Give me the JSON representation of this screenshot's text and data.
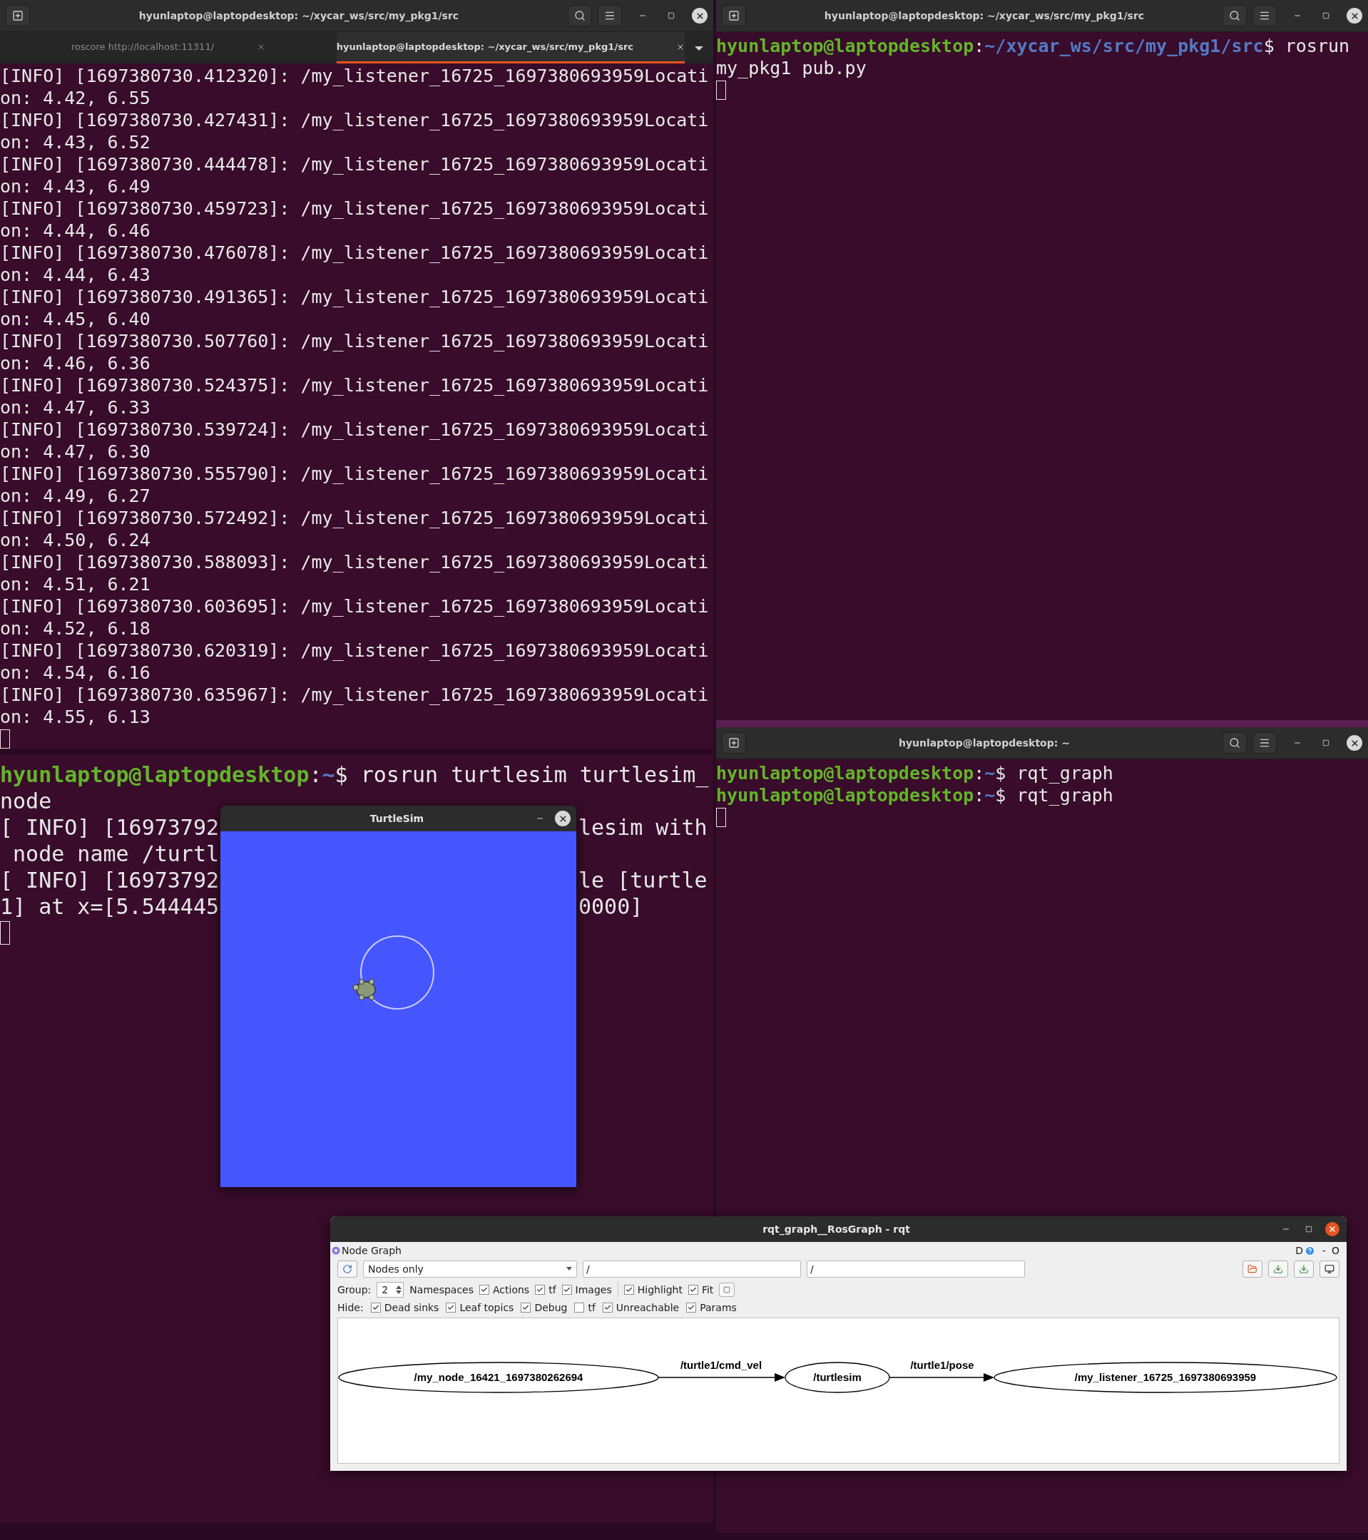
{
  "top_left_terminal": {
    "title": "hyunlaptop@laptopdesktop: ~/xycar_ws/src/my_pkg1/src",
    "tabs": [
      {
        "label": "roscore http://localhost:11311/",
        "selected": false
      },
      {
        "label": "hyunlaptop@laptopdesktop: ~/xycar_ws/src/my_pkg1/src",
        "selected": true
      }
    ],
    "lines": [
      {
        "kind": "output",
        "text": "[INFO] [1697380730.412320]: /my_listener_16725_1697380693959Locati"
      },
      {
        "kind": "output",
        "text": "on: 4.42, 6.55"
      },
      {
        "kind": "output",
        "text": "[INFO] [1697380730.427431]: /my_listener_16725_1697380693959Locati"
      },
      {
        "kind": "output",
        "text": "on: 4.43, 6.52"
      },
      {
        "kind": "output",
        "text": "[INFO] [1697380730.444478]: /my_listener_16725_1697380693959Locati"
      },
      {
        "kind": "output",
        "text": "on: 4.43, 6.49"
      },
      {
        "kind": "output",
        "text": "[INFO] [1697380730.459723]: /my_listener_16725_1697380693959Locati"
      },
      {
        "kind": "output",
        "text": "on: 4.44, 6.46"
      },
      {
        "kind": "output",
        "text": "[INFO] [1697380730.476078]: /my_listener_16725_1697380693959Locati"
      },
      {
        "kind": "output",
        "text": "on: 4.44, 6.43"
      },
      {
        "kind": "output",
        "text": "[INFO] [1697380730.491365]: /my_listener_16725_1697380693959Locati"
      },
      {
        "kind": "output",
        "text": "on: 4.45, 6.40"
      },
      {
        "kind": "output",
        "text": "[INFO] [1697380730.507760]: /my_listener_16725_1697380693959Locati"
      },
      {
        "kind": "output",
        "text": "on: 4.46, 6.36"
      },
      {
        "kind": "output",
        "text": "[INFO] [1697380730.524375]: /my_listener_16725_1697380693959Locati"
      },
      {
        "kind": "output",
        "text": "on: 4.47, 6.33"
      },
      {
        "kind": "output",
        "text": "[INFO] [1697380730.539724]: /my_listener_16725_1697380693959Locati"
      },
      {
        "kind": "output",
        "text": "on: 4.47, 6.30"
      },
      {
        "kind": "output",
        "text": "[INFO] [1697380730.555790]: /my_listener_16725_1697380693959Locati"
      },
      {
        "kind": "output",
        "text": "on: 4.49, 6.27"
      },
      {
        "kind": "output",
        "text": "[INFO] [1697380730.572492]: /my_listener_16725_1697380693959Locati"
      },
      {
        "kind": "output",
        "text": "on: 4.50, 6.24"
      },
      {
        "kind": "output",
        "text": "[INFO] [1697380730.588093]: /my_listener_16725_1697380693959Locati"
      },
      {
        "kind": "output",
        "text": "on: 4.51, 6.21"
      },
      {
        "kind": "output",
        "text": "[INFO] [1697380730.603695]: /my_listener_16725_1697380693959Locati"
      },
      {
        "kind": "output",
        "text": "on: 4.52, 6.18"
      },
      {
        "kind": "output",
        "text": "[INFO] [1697380730.620319]: /my_listener_16725_1697380693959Locati"
      },
      {
        "kind": "output",
        "text": "on: 4.54, 6.16"
      },
      {
        "kind": "output",
        "text": "[INFO] [1697380730.635967]: /my_listener_16725_1697380693959Locati"
      },
      {
        "kind": "output",
        "text": "on: 4.55, 6.13"
      }
    ]
  },
  "top_right_terminal": {
    "title": "hyunlaptop@laptopdesktop: ~/xycar_ws/src/my_pkg1/src",
    "lines": [
      {
        "kind": "prompt",
        "host": "hyunlaptop@laptopdesktop",
        "colon": ":",
        "path": "~/xycar_ws/src/my_pkg1/src",
        "command": "$ rosrun"
      },
      {
        "kind": "output",
        "text": "my_pkg1 pub.py"
      }
    ]
  },
  "bottom_left_terminal": {
    "lines": [
      {
        "kind": "prompt",
        "host": "hyunlaptop@laptopdesktop",
        "colon": ":",
        "path": "~",
        "command": "$ rosrun turtlesim turtlesim_"
      },
      {
        "kind": "output",
        "text": "node"
      },
      {
        "kind": "split",
        "left": "[ INFO] [16973792",
        "right": "lesim with"
      },
      {
        "kind": "split",
        "left": " node name /turtl"
      },
      {
        "kind": "split",
        "left": "[ INFO] [16973792",
        "right": "le [turtle"
      },
      {
        "kind": "split",
        "left": "1] at x=[5.544445",
        "right": "0000]"
      }
    ]
  },
  "bottom_right_terminal": {
    "title": "hyunlaptop@laptopdesktop: ~",
    "lines": [
      {
        "kind": "prompt",
        "host": "hyunlaptop@laptopdesktop",
        "colon": ":",
        "path": "~",
        "command": "$ rqt_graph"
      },
      {
        "kind": "prompt",
        "host": "hyunlaptop@laptopdesktop",
        "colon": ":",
        "path": "~",
        "command": "$ rqt_graph"
      }
    ]
  },
  "turtlesim": {
    "title": "TurtleSim"
  },
  "rqt": {
    "title": "rqt_graph__RosGraph - rqt",
    "plugin_title": "Node Graph",
    "corner": [
      "D",
      "-",
      "O"
    ],
    "view_mode": "Nodes only",
    "filters": [
      "/",
      "/"
    ],
    "group_label": "Group:",
    "group_value": "2",
    "namespaces_label": "Namespaces",
    "options": [
      {
        "label": "Actions",
        "checked": true
      },
      {
        "label": "tf",
        "checked": true
      },
      {
        "label": "Images",
        "checked": true
      },
      {
        "label": "Highlight",
        "checked": true
      },
      {
        "label": "Fit",
        "checked": true
      }
    ],
    "hide_label": "Hide:",
    "hide": [
      {
        "label": "Dead sinks",
        "checked": true
      },
      {
        "label": "Leaf topics",
        "checked": true
      },
      {
        "label": "Debug",
        "checked": true
      },
      {
        "label": "tf",
        "checked": false
      },
      {
        "label": "Unreachable",
        "checked": true
      },
      {
        "label": "Params",
        "checked": true
      }
    ],
    "graph": {
      "nodes": [
        {
          "label": "/my_node_16421_1697380262694"
        },
        {
          "label": "/turtlesim"
        },
        {
          "label": "/my_listener_16725_1697380693959"
        }
      ],
      "edges": [
        {
          "label": "/turtle1/cmd_vel"
        },
        {
          "label": "/turtle1/pose"
        }
      ]
    }
  }
}
